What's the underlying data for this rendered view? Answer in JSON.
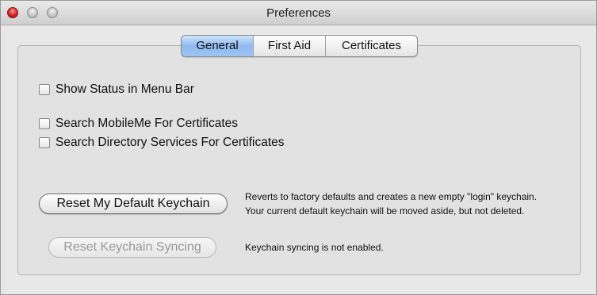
{
  "window": {
    "title": "Preferences"
  },
  "tabs": [
    {
      "label": "General",
      "selected": true
    },
    {
      "label": "First Aid",
      "selected": false
    },
    {
      "label": "Certificates",
      "selected": false
    }
  ],
  "options": {
    "show_status": {
      "label": "Show Status in Menu Bar",
      "checked": false
    },
    "search_mobileme": {
      "label": "Search MobileMe For Certificates",
      "checked": false
    },
    "search_directory": {
      "label": "Search Directory Services For Certificates",
      "checked": false
    }
  },
  "reset_default": {
    "label": "Reset My Default Keychain",
    "description_line1": "Reverts to factory defaults and creates a new empty \"login\" keychain.",
    "description_line2": "Your current default keychain will be moved aside, but not deleted."
  },
  "reset_syncing": {
    "label": "Reset Keychain Syncing",
    "enabled": false,
    "description": "Keychain syncing is not enabled."
  },
  "colors": {
    "selected_tab": "#9cc4f4",
    "close_button": "#d42020",
    "disabled_text": "#9a9a9a"
  },
  "icons": {
    "close": "close-button",
    "minimize": "minimize-button",
    "zoom": "zoom-button"
  }
}
